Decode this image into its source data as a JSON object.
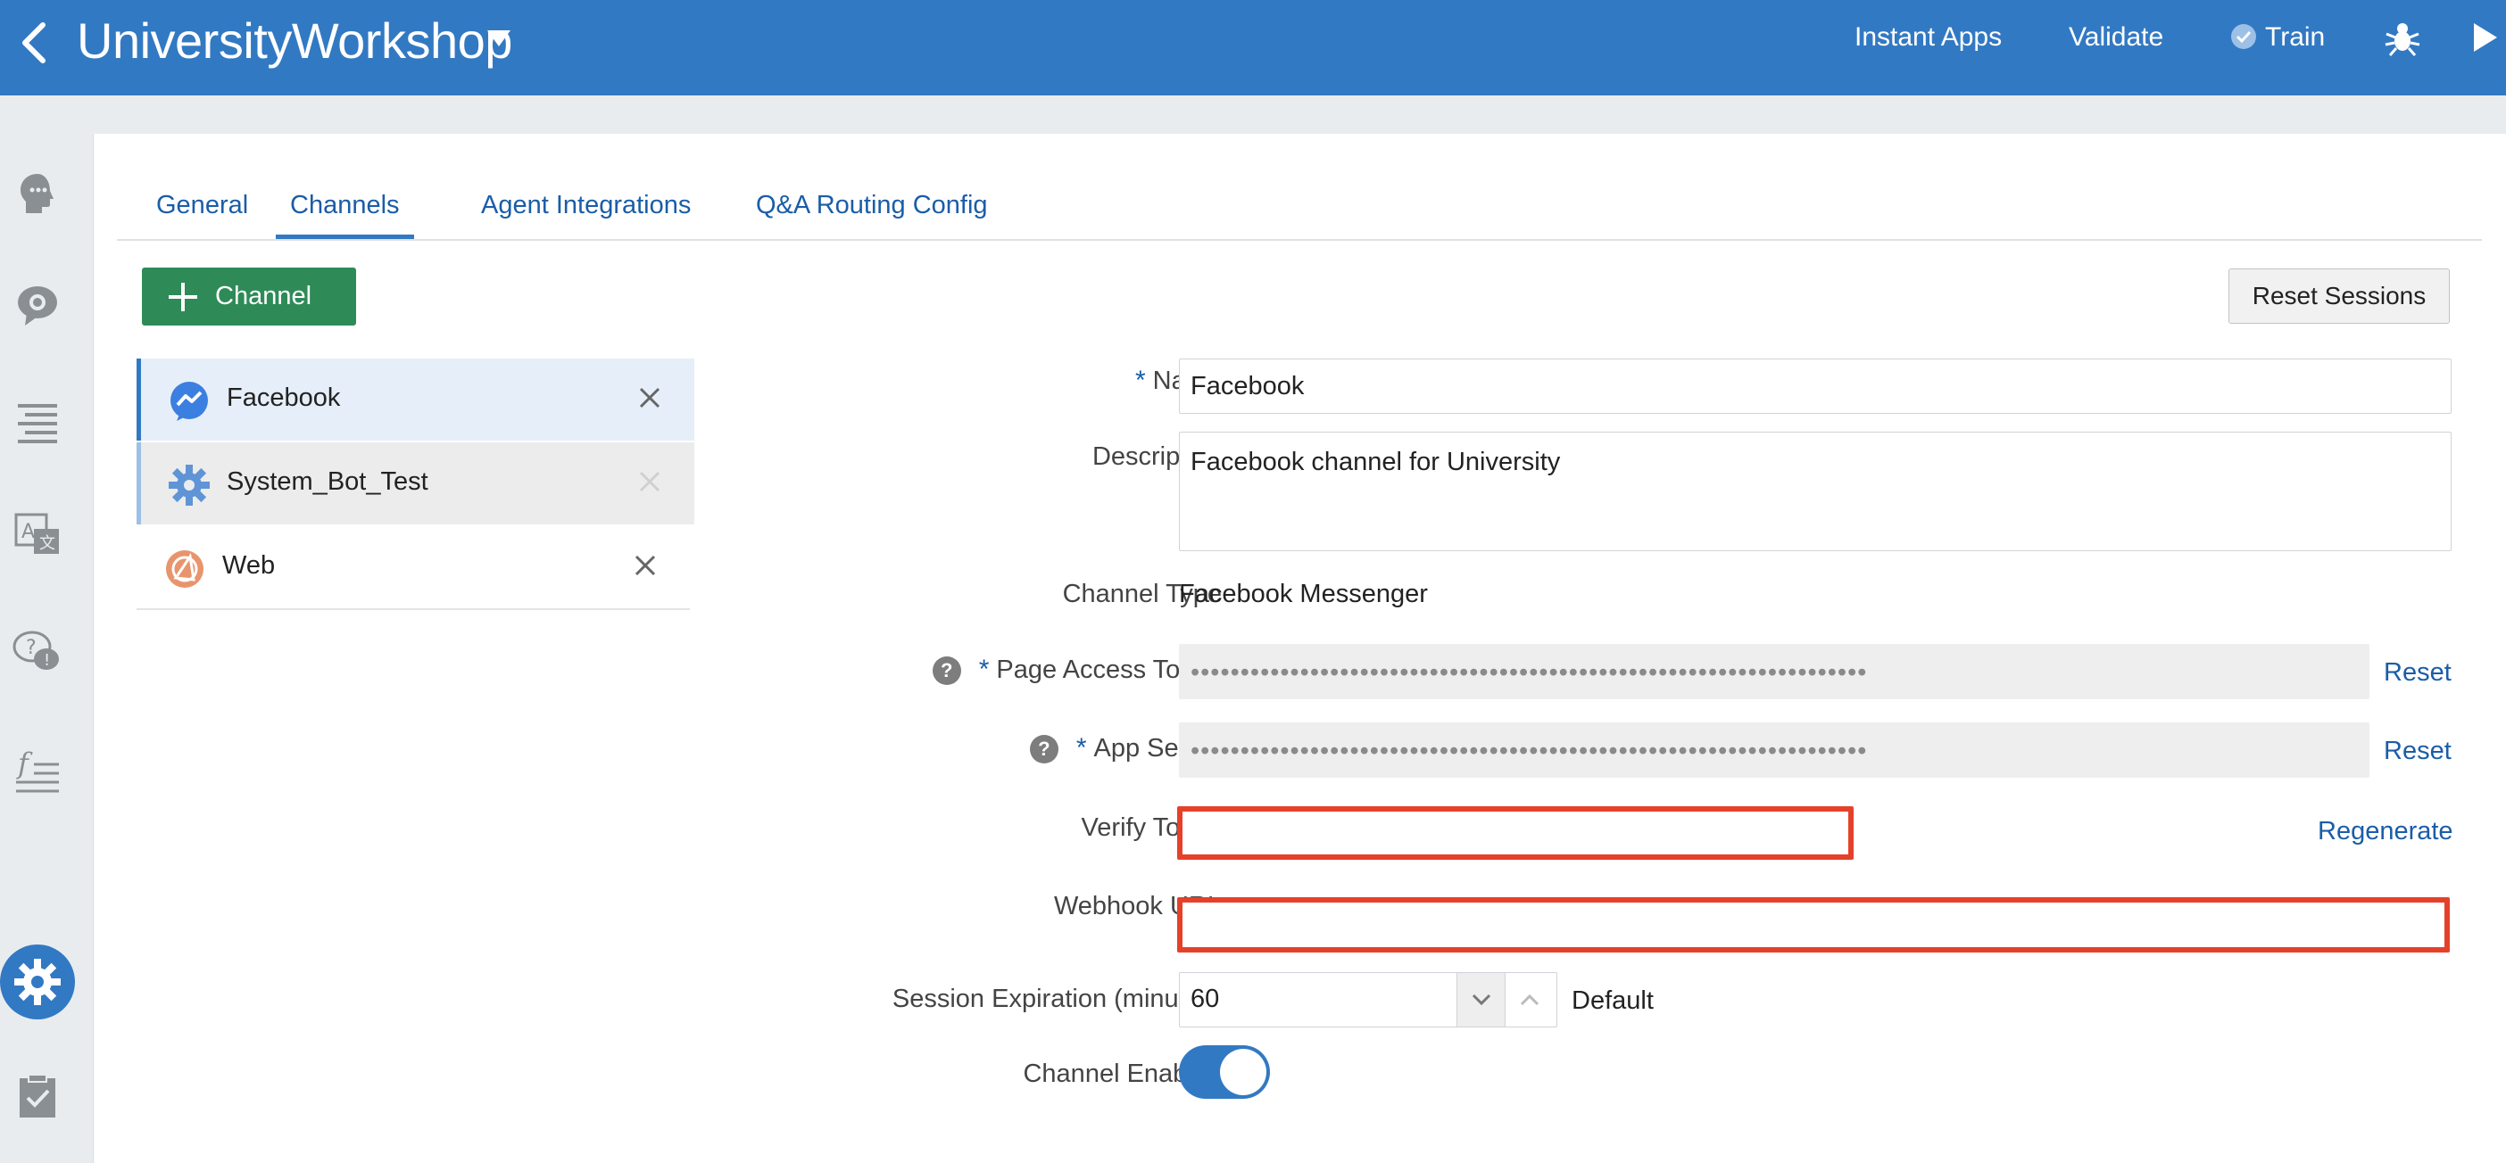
{
  "header": {
    "title": "UniversityWorkshop",
    "nav": [
      "Instant Apps",
      "Validate",
      "Train"
    ]
  },
  "tabs": [
    "General",
    "Channels",
    "Agent Integrations",
    "Q&A Routing Config"
  ],
  "toolbar": {
    "add_channel_label": "Channel",
    "reset_sessions_label": "Reset Sessions"
  },
  "channels": [
    {
      "name": "Facebook"
    },
    {
      "name": "System_Bot_Test"
    },
    {
      "name": "Web"
    }
  ],
  "form": {
    "name_label": "Name",
    "name_value": "Facebook",
    "description_label": "Description",
    "description_value": "Facebook channel for University",
    "channel_type_label": "Channel Type",
    "channel_type_value": "Facebook Messenger",
    "page_access_token_label": "Page Access Token",
    "page_access_token_value": "••••••••••••••••••••••••••••••••••••••••••••••••••••••••••••••••••••",
    "app_secret_label": "App Secret",
    "app_secret_value": "••••••••••••••••••••••••••••••••••••••••••••••••••••••••••••••••••••",
    "reset_link": "Reset",
    "verify_token_label": "Verify Token",
    "regenerate_link": "Regenerate",
    "webhook_url_label": "Webhook URL",
    "session_expiration_label": "Session Expiration (minutes)",
    "session_expiration_value": "60",
    "default_label": "Default",
    "channel_enabled_label": "Channel Enabled",
    "channel_enabled": true,
    "required_mark": "*",
    "help_mark": "?"
  },
  "colors": {
    "header_blue": "#3279c3",
    "add_button_green": "#2e8b57",
    "highlight_red": "#e5412a",
    "link_blue": "#1a5da8"
  },
  "icons": {
    "header": [
      "back-chevron-icon",
      "dropdown-caret-icon",
      "check-circle-icon",
      "bug-icon",
      "play-icon"
    ],
    "sidenav": [
      "intent-head-icon",
      "entity-bubble-icon",
      "flows-lines-icon",
      "translate-icon",
      "qna-bubble-icon",
      "function-icon",
      "settings-gear-icon",
      "clipboard-check-icon"
    ]
  }
}
